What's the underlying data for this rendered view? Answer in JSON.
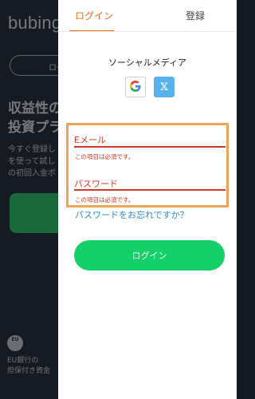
{
  "background": {
    "logo": "bubinga",
    "header_button": "ログ",
    "headline_line1": "収益性の",
    "headline_line2": "投資プラ",
    "body_line1": "今すぐ登録し",
    "body_line2": "を使って試し",
    "body_line3": "の初回入金ボ",
    "eu_badge": "EU",
    "footer_line1": "EU銀行の",
    "footer_line2": "担保付き資金"
  },
  "tabs": {
    "login": "ログイン",
    "register": "登録"
  },
  "social": {
    "title": "ソーシャルメディア",
    "google_icon": "google-icon",
    "x_icon": "x-icon",
    "x_glyph": "𝕏"
  },
  "form": {
    "email_label": "Eメール",
    "email_error": "この項目は必須です。",
    "password_label": "パスワード",
    "password_error": "この項目は必須です。",
    "forgot_link": "パスワードをお忘れですか？",
    "submit_label": "ログイン"
  },
  "colors": {
    "accent_orange": "#e86a1f",
    "error_red": "#d03a2a",
    "highlight_border": "#f0a45a",
    "link_blue": "#2a8ccd",
    "button_green": "#13d168",
    "x_blue": "#58b1eb"
  }
}
